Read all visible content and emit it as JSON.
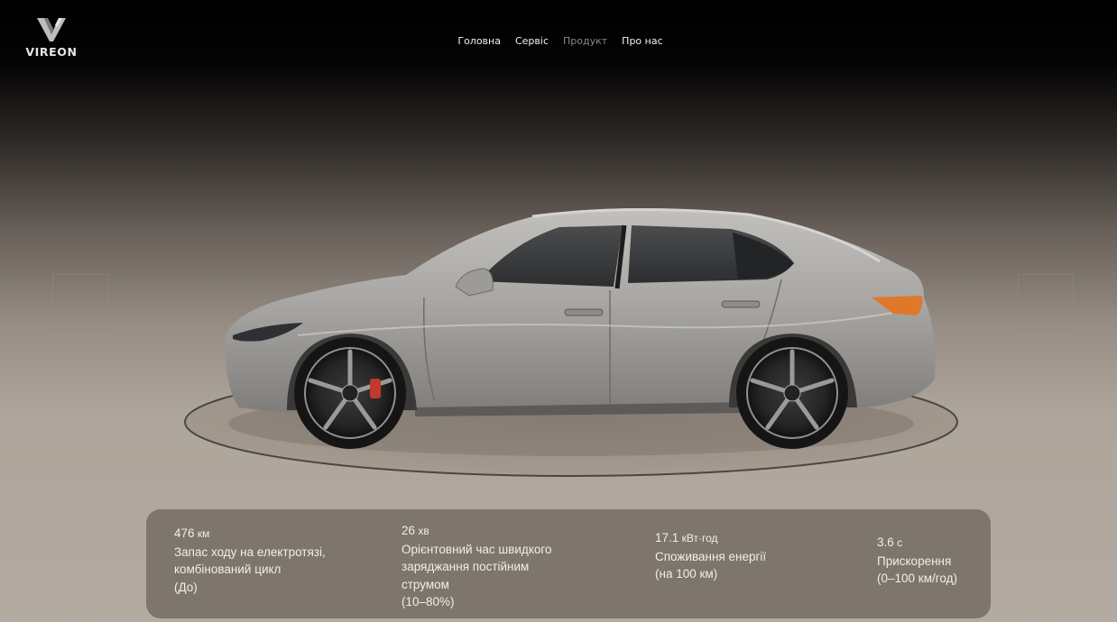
{
  "brand": {
    "name": "VIRЕON",
    "logo_icon": "v-chevron-logo-icon"
  },
  "nav": {
    "items": [
      "Головна",
      "Сервіс",
      "Продукт",
      "Про нас"
    ],
    "active_index": 2
  },
  "carousel": {
    "prev_icon": "chevron-left-icon",
    "next_icon": "chevron-right-icon",
    "prev_glyph": "‹",
    "next_glyph": "›"
  },
  "colors": {
    "panel": "#7e756c",
    "nav_active": "#8c8580",
    "car_body": "#a8a6a3",
    "taillight": "#e0782a"
  },
  "specs": [
    {
      "value": "476",
      "unit": " км",
      "lines": [
        "Запас ходу на електротязі,",
        "комбінований цикл",
        "(До)"
      ]
    },
    {
      "value": "26",
      "unit": " хв",
      "lines": [
        "Орієнтовний час швидкого",
        "заряджання постійним",
        "струмом",
        "(10–80%)"
      ]
    },
    {
      "value": "17.1",
      "unit": " кВт·год",
      "lines": [
        "Споживання енергії",
        "(на 100 км)"
      ]
    },
    {
      "value": "3.6",
      "unit": " с",
      "lines": [
        "Прискорення",
        "(0–100 км/год)"
      ]
    }
  ]
}
